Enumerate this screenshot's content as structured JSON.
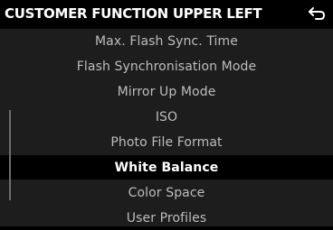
{
  "header": {
    "title": "CUSTOMER FUNCTION UPPER LEFT",
    "back_icon": "return-arrow-icon"
  },
  "menu": {
    "items": [
      {
        "label": "Max. Flash Sync. Time",
        "selected": false
      },
      {
        "label": "Flash Synchronisation Mode",
        "selected": false
      },
      {
        "label": "Mirror Up Mode",
        "selected": false
      },
      {
        "label": "ISO",
        "selected": false
      },
      {
        "label": "Photo File Format",
        "selected": false
      },
      {
        "label": "White Balance",
        "selected": true
      },
      {
        "label": "Color Space",
        "selected": false
      },
      {
        "label": "User Profiles",
        "selected": false
      }
    ]
  },
  "scrollbar": {
    "position_fraction": 0.42
  },
  "colors": {
    "background": "#000000",
    "list_background": "#1d1d1d",
    "item_text": "#bdbdbd",
    "selected_text": "#ffffff",
    "selected_background": "#000000"
  }
}
